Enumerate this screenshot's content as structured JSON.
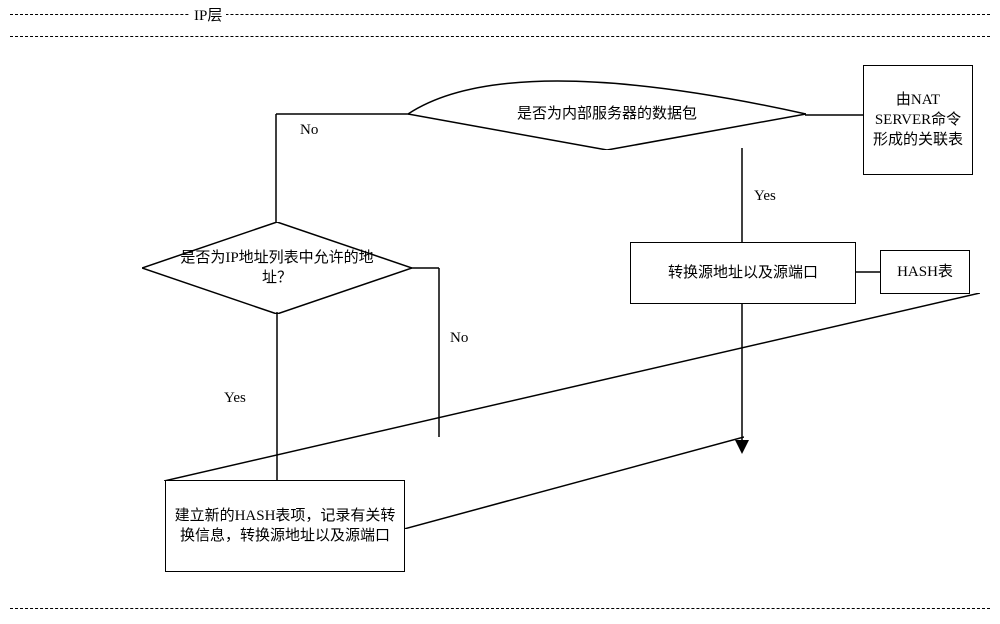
{
  "layer_label": "IP层",
  "d1": {
    "text": "是否为内部服务器的数据包",
    "no": "No",
    "yes": "Yes"
  },
  "d2": {
    "text": "是否为IP地址列表中允许的地址？",
    "no": "No",
    "yes": "Yes"
  },
  "box_assoc": "由NAT SERVER命令形成的关联表",
  "box_convert": "转换源地址以及源端口",
  "box_hash": "HASH表",
  "box_newhash": "建立新的HASH表项，记录有关转换信息，转换源地址以及源端口"
}
